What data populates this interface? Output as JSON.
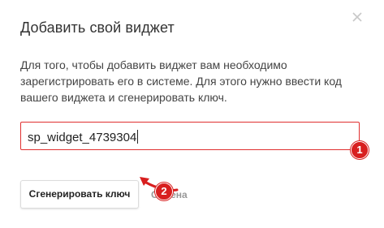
{
  "dialog": {
    "title": "Добавить свой виджет",
    "close_icon": "close-icon",
    "description_lines": [
      "Для того, чтобы добавить виджет вам необходимо",
      "зарегистрировать его в системе. Для этого нужно ввести код",
      "вашего виджета и сгенерировать ключ."
    ],
    "widget_code": {
      "value": "sp_widget_4739304"
    },
    "generate_button_label": "Сгенерировать ключ",
    "cancel_label": "Отмена",
    "annotations": {
      "step1": "1",
      "step2": "2"
    },
    "colors": {
      "accent_red": "#d81f1f",
      "input_border": "#e03030",
      "cancel_text": "#999999"
    }
  }
}
